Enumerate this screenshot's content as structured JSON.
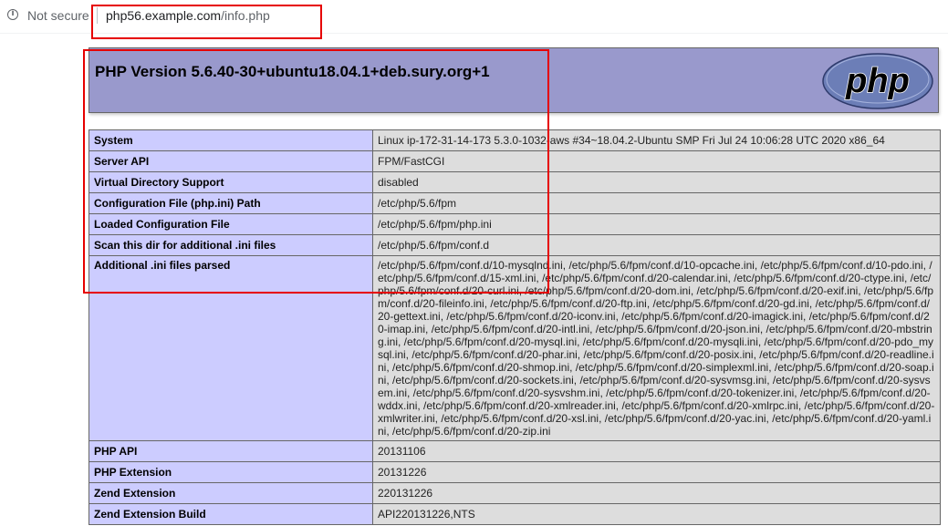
{
  "browser": {
    "security_label": "Not secure",
    "url_host": "php56.example.com",
    "url_path": "/info.php",
    "info_icon_glyph": "i"
  },
  "php": {
    "version_title": "PHP Version 5.6.40-30+ubuntu18.04.1+deb.sury.org+1",
    "logo_text": "php"
  },
  "rows": [
    {
      "key": "System",
      "value": "Linux ip-172-31-14-173 5.3.0-1032-aws #34~18.04.2-Ubuntu SMP Fri Jul 24 10:06:28 UTC 2020 x86_64"
    },
    {
      "key": "Server API",
      "value": "FPM/FastCGI"
    },
    {
      "key": "Virtual Directory Support",
      "value": "disabled"
    },
    {
      "key": "Configuration File (php.ini) Path",
      "value": "/etc/php/5.6/fpm"
    },
    {
      "key": "Loaded Configuration File",
      "value": "/etc/php/5.6/fpm/php.ini"
    },
    {
      "key": "Scan this dir for additional .ini files",
      "value": "/etc/php/5.6/fpm/conf.d"
    },
    {
      "key": "Additional .ini files parsed",
      "value": "/etc/php/5.6/fpm/conf.d/10-mysqlnd.ini, /etc/php/5.6/fpm/conf.d/10-opcache.ini, /etc/php/5.6/fpm/conf.d/10-pdo.ini, /etc/php/5.6/fpm/conf.d/15-xml.ini, /etc/php/5.6/fpm/conf.d/20-calendar.ini, /etc/php/5.6/fpm/conf.d/20-ctype.ini, /etc/php/5.6/fpm/conf.d/20-curl.ini, /etc/php/5.6/fpm/conf.d/20-dom.ini, /etc/php/5.6/fpm/conf.d/20-exif.ini, /etc/php/5.6/fpm/conf.d/20-fileinfo.ini, /etc/php/5.6/fpm/conf.d/20-ftp.ini, /etc/php/5.6/fpm/conf.d/20-gd.ini, /etc/php/5.6/fpm/conf.d/20-gettext.ini, /etc/php/5.6/fpm/conf.d/20-iconv.ini, /etc/php/5.6/fpm/conf.d/20-imagick.ini, /etc/php/5.6/fpm/conf.d/20-imap.ini, /etc/php/5.6/fpm/conf.d/20-intl.ini, /etc/php/5.6/fpm/conf.d/20-json.ini, /etc/php/5.6/fpm/conf.d/20-mbstring.ini, /etc/php/5.6/fpm/conf.d/20-mysql.ini, /etc/php/5.6/fpm/conf.d/20-mysqli.ini, /etc/php/5.6/fpm/conf.d/20-pdo_mysql.ini, /etc/php/5.6/fpm/conf.d/20-phar.ini, /etc/php/5.6/fpm/conf.d/20-posix.ini, /etc/php/5.6/fpm/conf.d/20-readline.ini, /etc/php/5.6/fpm/conf.d/20-shmop.ini, /etc/php/5.6/fpm/conf.d/20-simplexml.ini, /etc/php/5.6/fpm/conf.d/20-soap.ini, /etc/php/5.6/fpm/conf.d/20-sockets.ini, /etc/php/5.6/fpm/conf.d/20-sysvmsg.ini, /etc/php/5.6/fpm/conf.d/20-sysvsem.ini, /etc/php/5.6/fpm/conf.d/20-sysvshm.ini, /etc/php/5.6/fpm/conf.d/20-tokenizer.ini, /etc/php/5.6/fpm/conf.d/20-wddx.ini, /etc/php/5.6/fpm/conf.d/20-xmlreader.ini, /etc/php/5.6/fpm/conf.d/20-xmlrpc.ini, /etc/php/5.6/fpm/conf.d/20-xmlwriter.ini, /etc/php/5.6/fpm/conf.d/20-xsl.ini, /etc/php/5.6/fpm/conf.d/20-yac.ini, /etc/php/5.6/fpm/conf.d/20-yaml.ini, /etc/php/5.6/fpm/conf.d/20-zip.ini"
    },
    {
      "key": "PHP API",
      "value": "20131106"
    },
    {
      "key": "PHP Extension",
      "value": "20131226"
    },
    {
      "key": "Zend Extension",
      "value": "220131226"
    },
    {
      "key": "Zend Extension Build",
      "value": "API220131226,NTS"
    }
  ],
  "colors": {
    "header_bg": "#9999cc",
    "key_bg": "#ccccff",
    "value_bg": "#dddddd",
    "annotation": "#e60000",
    "logo_bg": "#6c7eb7"
  }
}
